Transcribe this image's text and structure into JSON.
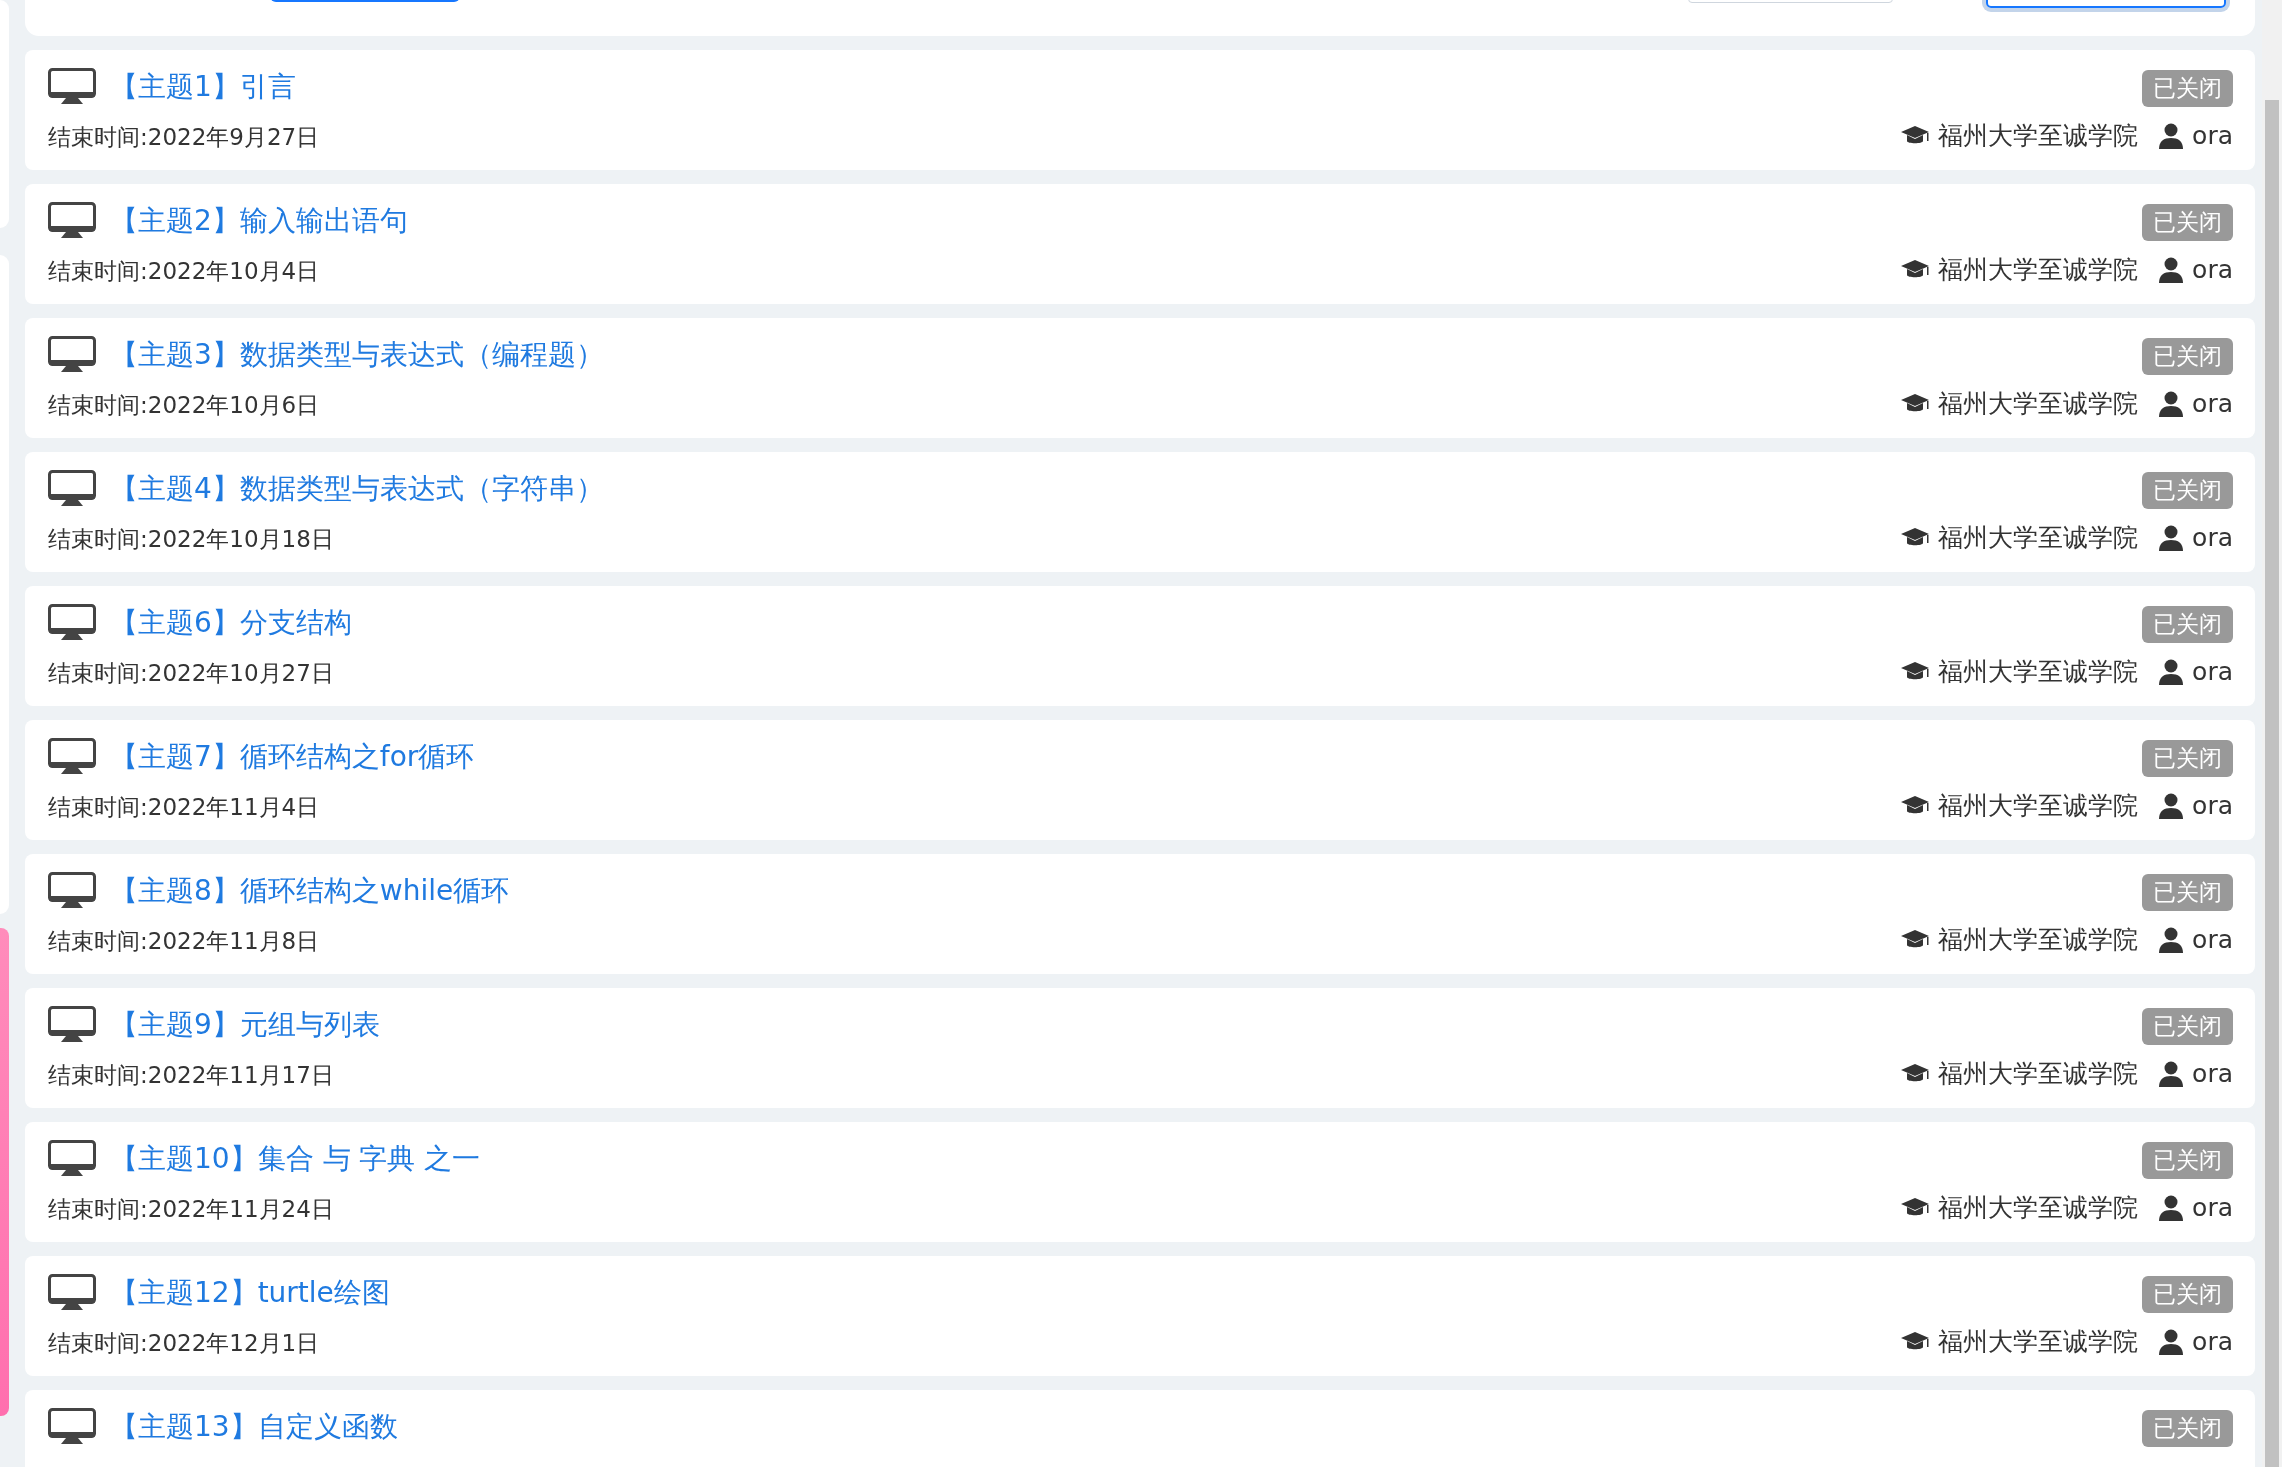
{
  "topics": [
    {
      "title": "【主题1】引言",
      "end_time": "结束时间:2022年9月27日",
      "status": "已关闭",
      "school": "福州大学至诚学院",
      "user": "ora"
    },
    {
      "title": "【主题2】输入输出语句",
      "end_time": "结束时间:2022年10月4日",
      "status": "已关闭",
      "school": "福州大学至诚学院",
      "user": "ora"
    },
    {
      "title": "【主题3】数据类型与表达式（编程题）",
      "end_time": "结束时间:2022年10月6日",
      "status": "已关闭",
      "school": "福州大学至诚学院",
      "user": "ora"
    },
    {
      "title": "【主题4】数据类型与表达式（字符串）",
      "end_time": "结束时间:2022年10月18日",
      "status": "已关闭",
      "school": "福州大学至诚学院",
      "user": "ora"
    },
    {
      "title": "【主题6】分支结构",
      "end_time": "结束时间:2022年10月27日",
      "status": "已关闭",
      "school": "福州大学至诚学院",
      "user": "ora"
    },
    {
      "title": "【主题7】循环结构之for循环",
      "end_time": "结束时间:2022年11月4日",
      "status": "已关闭",
      "school": "福州大学至诚学院",
      "user": "ora"
    },
    {
      "title": "【主题8】循环结构之while循环",
      "end_time": "结束时间:2022年11月8日",
      "status": "已关闭",
      "school": "福州大学至诚学院",
      "user": "ora"
    },
    {
      "title": "【主题9】元组与列表",
      "end_time": "结束时间:2022年11月17日",
      "status": "已关闭",
      "school": "福州大学至诚学院",
      "user": "ora"
    },
    {
      "title": "【主题10】集合 与 字典 之一",
      "end_time": "结束时间:2022年11月24日",
      "status": "已关闭",
      "school": "福州大学至诚学院",
      "user": "ora"
    },
    {
      "title": "【主题12】turtle绘图",
      "end_time": "结束时间:2022年12月1日",
      "status": "已关闭",
      "school": "福州大学至诚学院",
      "user": "ora"
    },
    {
      "title": "【主题13】自定义函数",
      "status": "已关闭"
    }
  ]
}
